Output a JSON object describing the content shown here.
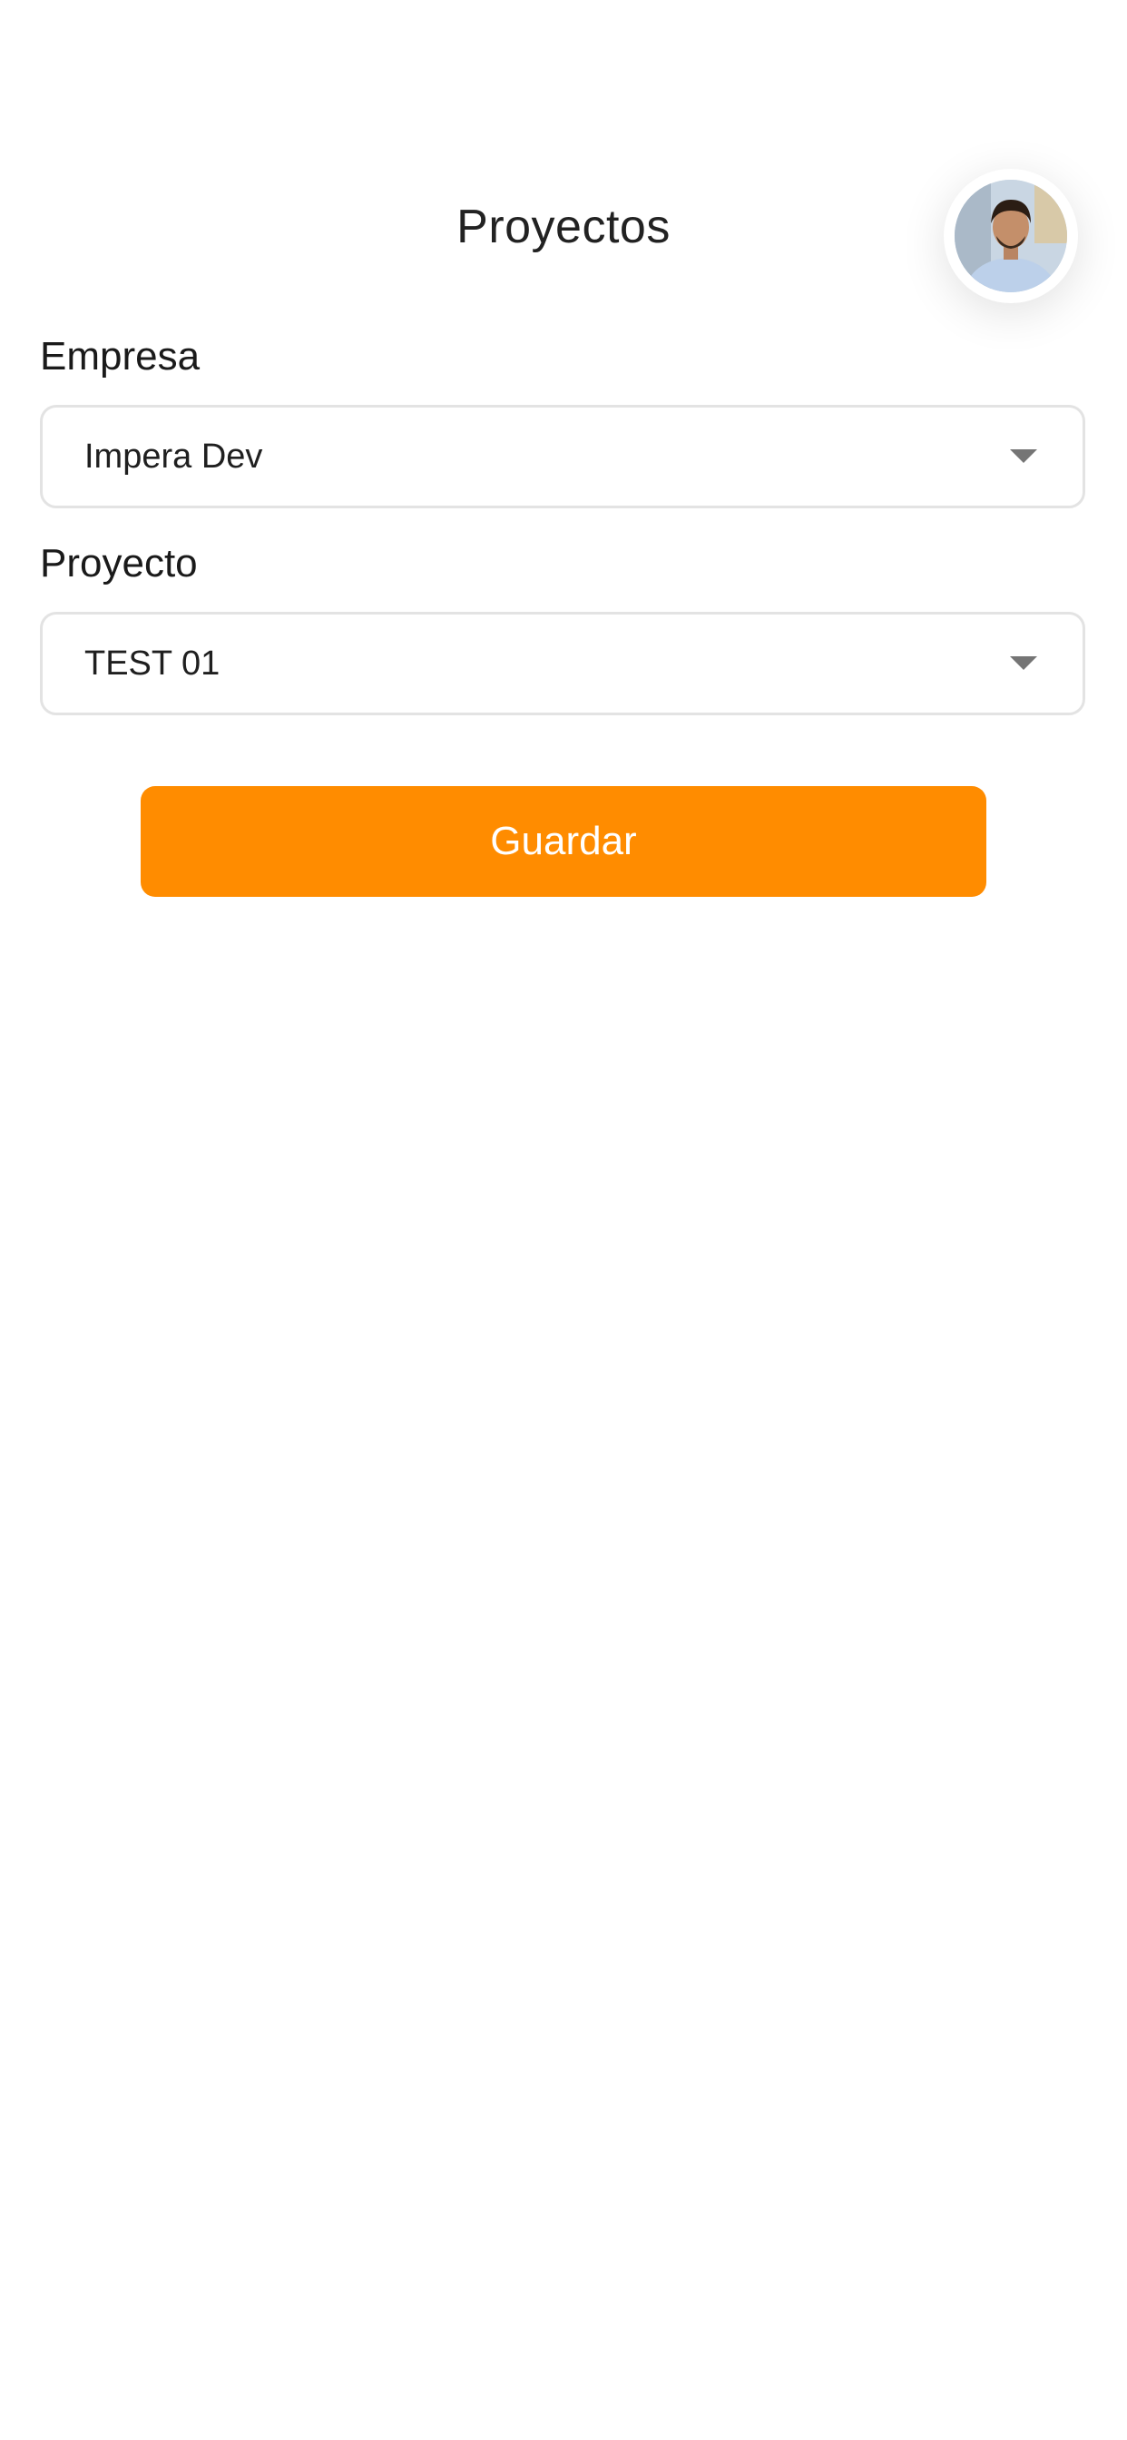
{
  "header": {
    "title": "Proyectos",
    "avatar_icon": "user-avatar-photo"
  },
  "form": {
    "empresa": {
      "label": "Empresa",
      "value": "Impera Dev"
    },
    "proyecto": {
      "label": "Proyecto",
      "value": "TEST 01"
    },
    "save_label": "Guardar"
  },
  "colors": {
    "accent": "#ff8c00",
    "border": "#e3e3e3",
    "caret": "#757575",
    "background": "#ffffff"
  }
}
